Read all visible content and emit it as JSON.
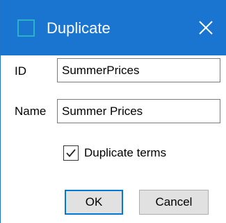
{
  "window": {
    "title": "Duplicate"
  },
  "form": {
    "id_label": "ID",
    "id_value": "SummerPrices",
    "name_label": "Name",
    "name_value": "Summer Prices",
    "duplicate_terms_label": "Duplicate terms",
    "duplicate_terms_checked": true
  },
  "buttons": {
    "ok_label": "OK",
    "cancel_label": "Cancel"
  },
  "colors": {
    "titlebar": "#1a75d0",
    "app_icon_border": "#2ab3c4",
    "default_button_border": "#0078d7"
  },
  "icons": {
    "app": "app-icon",
    "close": "close-icon",
    "check": "checkmark-icon"
  }
}
